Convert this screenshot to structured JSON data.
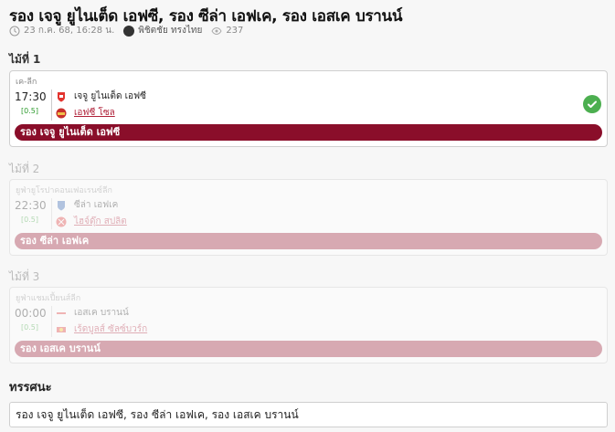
{
  "title": "รอง เจจู ยูไนเต็ด เอฟซี, รอง ซีล่า เอฟเค, รอง เอสเค บรานน์",
  "meta": {
    "date": "23 ก.ค. 68, 16:28 น.",
    "author": "พิชิตชัย ทรงไทย",
    "views": "237"
  },
  "pairs": [
    {
      "label": "ไม้ที่ 1",
      "league": "เค-ลีก",
      "time": "17:30",
      "odds": "[0.5]",
      "home": "เจจู ยูไนเต็ด เอฟซี",
      "away": "เอฟซี โซล",
      "pick": "รอง เจจู ยูไนเต็ด เอฟซี",
      "status": "win"
    },
    {
      "label": "ไม้ที่ 2",
      "league": "ยูฟ่ายูโรปาคอนเฟอเรนซ์ลีก",
      "time": "22:30",
      "odds": "[0.5]",
      "home": "ซีล่า เอฟเค",
      "away": "ไฮจ์ดุ๊ก สปลิต",
      "pick": "รอง ซีล่า เอฟเค",
      "status": "pending"
    },
    {
      "label": "ไม้ที่ 3",
      "league": "ยูฟ่าแชมเปี้ยนส์ลีก",
      "time": "00:00",
      "odds": "[0.5]",
      "home": "เอสเค บรานน์",
      "away": "เร้ดบูลส์ ซัลซ์บวร์ก",
      "pick": "รอง เอสเค บรานน์",
      "status": "pending"
    }
  ],
  "summary": {
    "label": "ทรรศนะ",
    "text": "รอง เจจู ยูไนเต็ด เอฟซี, รอง ซีล่า เอฟเค, รอง เอสเค บรานน์"
  },
  "colors": {
    "pick_active": "#8a0e2a",
    "pick_dim": "#d7a9b2",
    "win": "#4caf50",
    "odds": "#2e9b2e"
  },
  "icons": [
    "clock-icon",
    "avatar",
    "eye-icon",
    "team-logo",
    "check-icon"
  ]
}
